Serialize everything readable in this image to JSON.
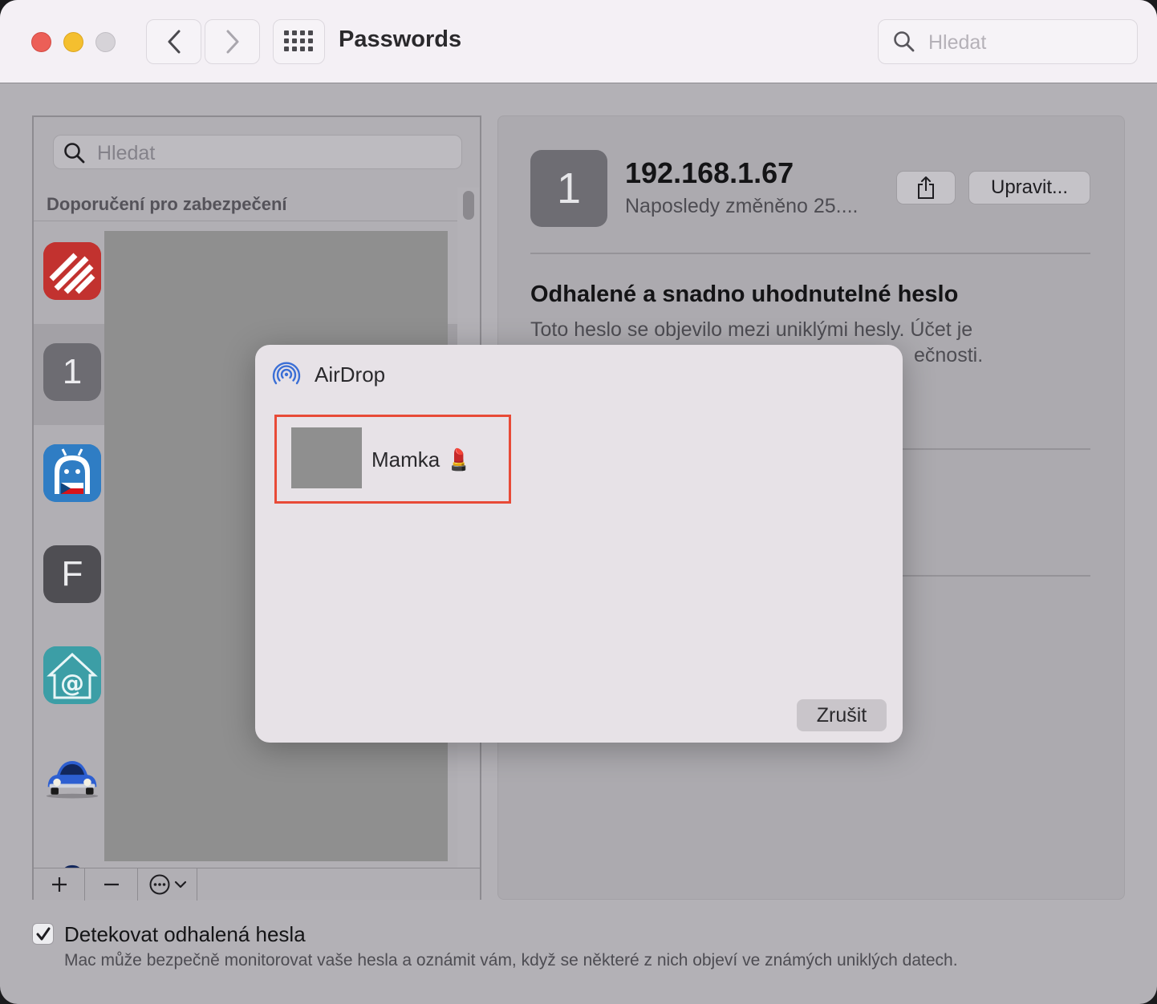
{
  "window": {
    "title": "Passwords",
    "search_placeholder": "Hledat"
  },
  "sidebar": {
    "search_placeholder": "Hledat",
    "section_header": "Doporučení pro zabezpečení",
    "items": [
      {
        "icon": "red-stripes-app-icon"
      },
      {
        "icon": "letter-icon",
        "letter": "1",
        "selected": true
      },
      {
        "icon": "android-czech-app-icon"
      },
      {
        "icon": "letter-icon",
        "letter": "F"
      },
      {
        "icon": "house-at-mail-icon"
      },
      {
        "icon": "blue-beetle-car-icon"
      },
      {
        "icon": "blue-car-icon"
      }
    ],
    "bottom_buttons": [
      "+",
      "−",
      "⋯"
    ]
  },
  "detail": {
    "icon_letter": "1",
    "title": "192.168.1.67",
    "subtitle": "Naposledy změněno 25....",
    "edit_label": "Upravit...",
    "warning_title": "Odhalené a snadno uhodnutelné heslo",
    "warning_line1": "Toto heslo se objevilo mezi uniklými hesly. Účet je",
    "warning_line2": "ečnosti."
  },
  "footer": {
    "checkbox_checked": true,
    "checkbox_label": "Detekovat odhalená hesla",
    "description": "Mac může bezpečně monitorovat vaše hesla a oznámit vám, když se některé z nich objeví ve známých uniklých datech."
  },
  "airdrop": {
    "title": "AirDrop",
    "contact_name": "Mamka 💄",
    "cancel_label": "Zrušit",
    "highlight_color": "#e84a37"
  },
  "colors": {
    "red_light": "#ec5f57",
    "yellow_light": "#f4bf2f",
    "accent_airdrop": "#3b6fd6"
  }
}
